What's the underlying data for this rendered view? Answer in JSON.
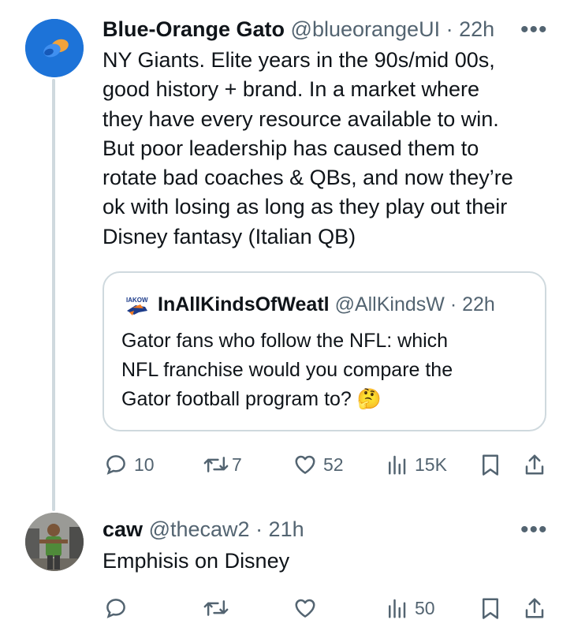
{
  "tweet": {
    "author_name": "Blue-Orange Gato",
    "handle": "@blueorangeUI",
    "time": "· 22h",
    "more_icon": "more-horizontal-icon",
    "lines": [
      "NY Giants. Elite years in the 90s/mid 00s,",
      "good history + brand. In a market where",
      "they have every resource available to win.",
      "But poor leadership has caused them to",
      "rotate bad coaches & QBs, and now they’re",
      "ok with losing as long as they play out their",
      "Disney fantasy (Italian QB)"
    ],
    "quote": {
      "author_name": "InAllKindsOfWeatl",
      "handle": "@AllKindsW",
      "time": "· 22h",
      "logo_icon": "gator-logo-icon",
      "lines": [
        "Gator fans who follow the NFL: which",
        "NFL franchise would you compare the",
        "Gator football program to? 🤔"
      ]
    },
    "actions": {
      "replies": "10",
      "reposts": "7",
      "likes": "52",
      "views": "15K"
    }
  },
  "reply": {
    "author_name": "caw",
    "handle": "@thecaw2",
    "time": "· 21h",
    "text": "Emphisis on Disney",
    "actions": {
      "replies": "",
      "reposts": "",
      "likes": "",
      "views": "50"
    }
  },
  "colors": {
    "text": "#0f1419",
    "secondary": "#536471",
    "border": "#cfd9de",
    "avatar_blue": "#1d73d8",
    "avatar_orange": "#f2a33a"
  }
}
